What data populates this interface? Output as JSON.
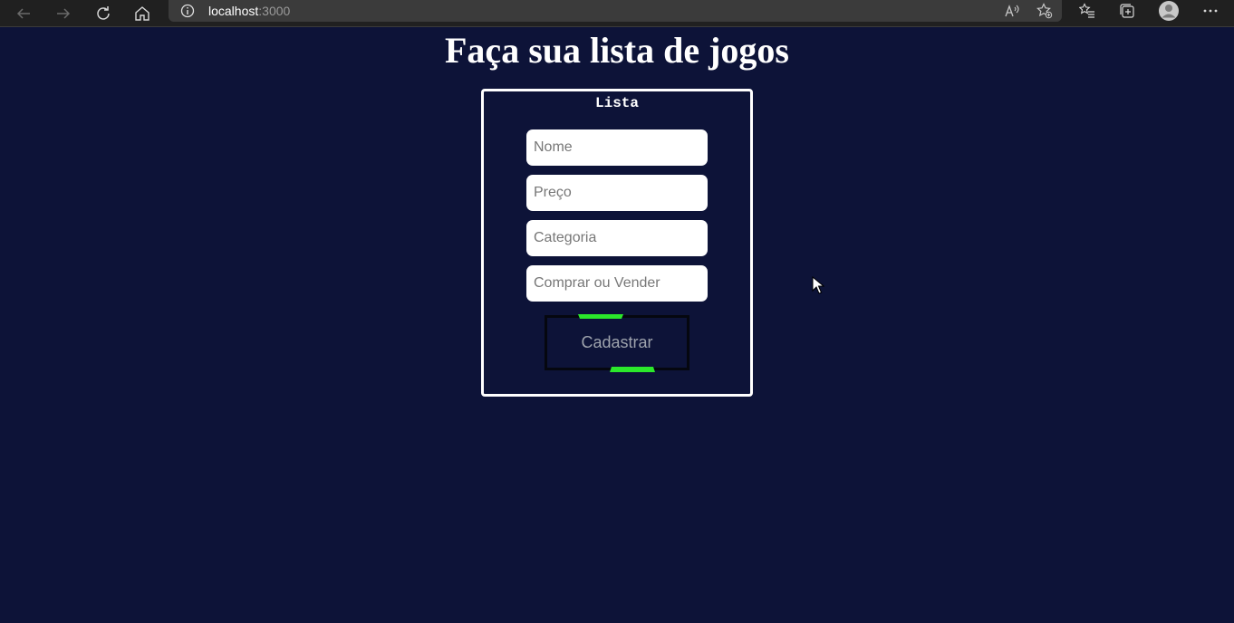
{
  "browser": {
    "url_host": "localhost",
    "url_port": ":3000",
    "icons": {
      "back": "arrow-left-icon",
      "forward": "arrow-right-icon",
      "refresh": "refresh-icon",
      "home": "home-icon",
      "site_info": "info-icon",
      "read_aloud": "read-aloud-icon",
      "add_favorite": "add-favorite-icon",
      "favorites": "favorites-icon",
      "collections": "collections-icon",
      "profile": "profile-icon",
      "more": "more-icon"
    }
  },
  "page": {
    "title": "Faça sua lista de jogos"
  },
  "form": {
    "legend": "Lista",
    "fields": [
      {
        "placeholder": "Nome",
        "value": ""
      },
      {
        "placeholder": "Preço",
        "value": ""
      },
      {
        "placeholder": "Categoria",
        "value": ""
      },
      {
        "placeholder": "Comprar ou Vender",
        "value": ""
      }
    ],
    "submit_label": "Cadastrar"
  },
  "colors": {
    "page_background": "#0d1338",
    "accent_glow": "#2be82b",
    "form_border": "#ffffff"
  }
}
